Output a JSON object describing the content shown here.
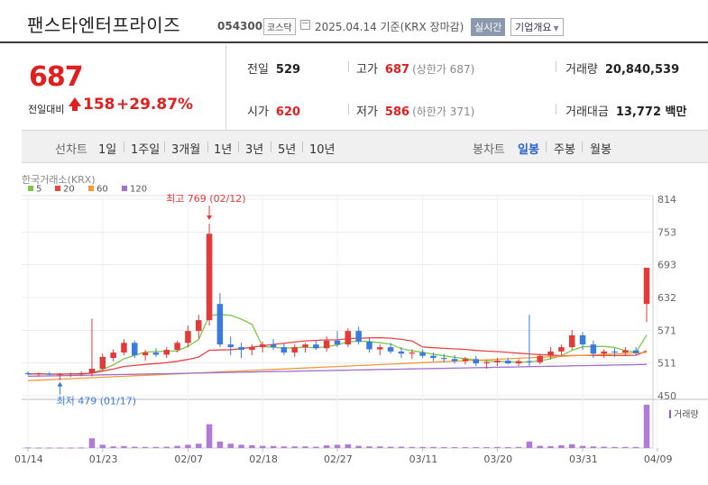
{
  "header": {
    "name": "팬스타엔터프라이즈",
    "code": "054300",
    "market": "코스닥",
    "date_label": "2025.04.14 기준(KRX 장마감)",
    "realtime_btn": "실시간",
    "corp_info_btn": "기업개요",
    "icons": {
      "calendar": "calendar-icon",
      "dropdown": "chevron-down-icon"
    }
  },
  "quote": {
    "price": "687",
    "compare_label": "전일대비",
    "change": "158",
    "change_pct": "+29.87%",
    "prev_label": "전일",
    "prev": "529",
    "high_label": "고가",
    "high": "687",
    "upper_limit": "(상한가 687)",
    "volume_label": "거래량",
    "volume": "20,840,539",
    "open_label": "시가",
    "open": "620",
    "low_label": "저가",
    "low": "586",
    "lower_limit": "(하한가 371)",
    "amount_label": "거래대금",
    "amount": "13,772 백만",
    "colors": {
      "up": "#e02020"
    }
  },
  "periods": {
    "line_label": "선차트",
    "line_items": [
      "1일",
      "1주일",
      "3개월",
      "1년",
      "3년",
      "5년",
      "10년"
    ],
    "candle_label": "봉차트",
    "candle_items": [
      "일봉",
      "주봉",
      "월봉"
    ],
    "candle_selected": 0
  },
  "chart_data": {
    "type": "candlestick",
    "source_label": "한국거래소(KRX)",
    "legend": [
      {
        "name": "5",
        "color": "#7cc74a"
      },
      {
        "name": "20",
        "color": "#e94545"
      },
      {
        "name": "60",
        "color": "#f29a3c"
      },
      {
        "name": "120",
        "color": "#a070cf"
      }
    ],
    "y_ticks": [
      814,
      753,
      693,
      632,
      571,
      511,
      450
    ],
    "y_range": [
      450,
      814
    ],
    "x_ticks": [
      "01/14",
      "01/23",
      "02/07",
      "02/18",
      "02/27",
      "03/11",
      "03/20",
      "03/31",
      "04/09"
    ],
    "x_tick_index": [
      0,
      7,
      15,
      22,
      29,
      37,
      44,
      52,
      59
    ],
    "annotations": {
      "high": {
        "label": "최고 769 (02/12)",
        "index": 17,
        "value": 769
      },
      "low": {
        "label": "최저 479 (01/17)",
        "index": 3,
        "value": 479
      }
    },
    "volume_label": "거래량",
    "candles": [
      [
        492,
        495,
        488,
        490
      ],
      [
        490,
        493,
        487,
        491
      ],
      [
        491,
        494,
        488,
        489
      ],
      [
        489,
        492,
        479,
        490
      ],
      [
        490,
        493,
        485,
        491
      ],
      [
        491,
        495,
        486,
        492
      ],
      [
        492,
        593,
        486,
        500
      ],
      [
        500,
        528,
        495,
        522
      ],
      [
        520,
        536,
        514,
        530
      ],
      [
        530,
        555,
        525,
        548
      ],
      [
        548,
        552,
        520,
        525
      ],
      [
        525,
        535,
        515,
        530
      ],
      [
        530,
        538,
        522,
        526
      ],
      [
        526,
        540,
        520,
        535
      ],
      [
        535,
        552,
        530,
        548
      ],
      [
        548,
        580,
        540,
        570
      ],
      [
        570,
        600,
        556,
        590
      ],
      [
        590,
        769,
        580,
        750
      ],
      [
        620,
        640,
        540,
        545
      ],
      [
        545,
        560,
        525,
        540
      ],
      [
        540,
        548,
        520,
        535
      ],
      [
        535,
        545,
        525,
        540
      ],
      [
        540,
        550,
        530,
        545
      ],
      [
        545,
        555,
        535,
        540
      ],
      [
        540,
        548,
        525,
        530
      ],
      [
        530,
        545,
        522,
        540
      ],
      [
        540,
        548,
        530,
        545
      ],
      [
        545,
        552,
        535,
        538
      ],
      [
        538,
        560,
        532,
        552
      ],
      [
        552,
        570,
        540,
        545
      ],
      [
        545,
        575,
        540,
        570
      ],
      [
        570,
        578,
        545,
        550
      ],
      [
        550,
        556,
        530,
        536
      ],
      [
        536,
        545,
        525,
        540
      ],
      [
        540,
        548,
        528,
        532
      ],
      [
        532,
        540,
        520,
        528
      ],
      [
        528,
        536,
        518,
        530
      ],
      [
        530,
        536,
        520,
        524
      ],
      [
        524,
        530,
        514,
        520
      ],
      [
        520,
        528,
        512,
        518
      ],
      [
        518,
        525,
        510,
        514
      ],
      [
        514,
        522,
        508,
        518
      ],
      [
        518,
        524,
        505,
        510
      ],
      [
        510,
        516,
        500,
        512
      ],
      [
        512,
        520,
        505,
        515
      ],
      [
        515,
        520,
        508,
        510
      ],
      [
        510,
        518,
        505,
        514
      ],
      [
        514,
        600,
        505,
        512
      ],
      [
        512,
        528,
        508,
        524
      ],
      [
        524,
        540,
        518,
        532
      ],
      [
        532,
        545,
        525,
        540
      ],
      [
        540,
        572,
        535,
        562
      ],
      [
        562,
        568,
        535,
        545
      ],
      [
        545,
        552,
        520,
        528
      ],
      [
        528,
        536,
        520,
        532
      ],
      [
        532,
        538,
        522,
        530
      ],
      [
        530,
        540,
        524,
        534
      ],
      [
        534,
        540,
        525,
        529
      ],
      [
        620,
        687,
        586,
        687
      ]
    ],
    "volumes": [
      0.05,
      0.04,
      0.04,
      0.04,
      0.04,
      0.05,
      0.9,
      0.3,
      0.15,
      0.18,
      0.12,
      0.1,
      0.1,
      0.12,
      0.2,
      0.3,
      0.4,
      2.2,
      0.6,
      0.4,
      0.3,
      0.25,
      0.2,
      0.18,
      0.15,
      0.15,
      0.15,
      0.12,
      0.25,
      0.3,
      0.35,
      0.2,
      0.15,
      0.15,
      0.12,
      0.12,
      0.1,
      0.1,
      0.1,
      0.08,
      0.08,
      0.08,
      0.08,
      0.08,
      0.1,
      0.08,
      0.1,
      0.6,
      0.2,
      0.18,
      0.25,
      0.35,
      0.2,
      0.15,
      0.12,
      0.1,
      0.1,
      0.1,
      4.0
    ]
  }
}
